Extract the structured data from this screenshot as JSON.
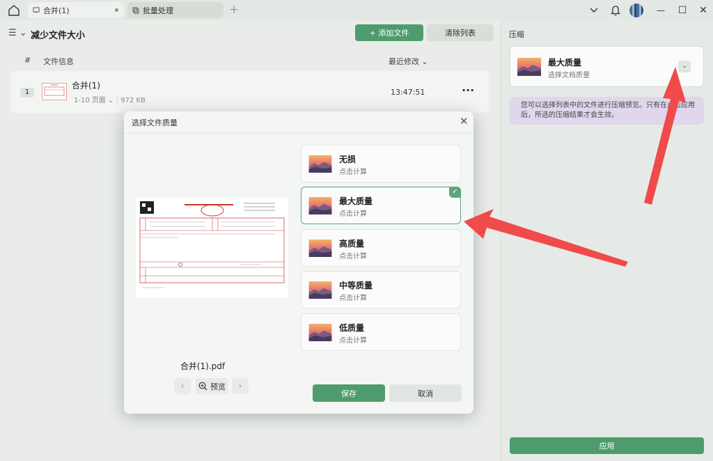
{
  "titlebar": {
    "tabs": [
      {
        "label": "合并(1)"
      },
      {
        "label": "批量处理"
      }
    ],
    "plus": "+",
    "window_buttons": {
      "minimize": "—",
      "maximize": "☐",
      "close": "✕"
    }
  },
  "main": {
    "menu_icon": "☰ ⌄",
    "title": "减少文件大小",
    "add_button": "+ 添加文件",
    "clear_button": "清除列表",
    "columns": {
      "index": "#",
      "info": "文件信息",
      "modified": "最近修改 ⌄"
    },
    "files": [
      {
        "index": "1",
        "name": "合并(1)",
        "pages": "1-10 页面 ⌄",
        "size": "972 KB",
        "time": "13:47:51",
        "more": "···"
      }
    ]
  },
  "panel": {
    "title": "压缩",
    "selected_quality": "最大质量",
    "selected_sub": "选择文档质量",
    "dropdown": "⌄",
    "tip": "您可以选择列表中的文件进行压缩预览。只有在点击应用后，所选的压缩结果才会生效。",
    "apply_button": "应用"
  },
  "dialog": {
    "title": "选择文件质量",
    "close": "✕",
    "pdf_name": "合并(1).pdf",
    "prev": "‹",
    "next": "›",
    "zoom_label": "预览",
    "options": [
      {
        "name": "无损",
        "sub": "点击计算",
        "selected": false
      },
      {
        "name": "最大质量",
        "sub": "点击计算",
        "selected": true
      },
      {
        "name": "高质量",
        "sub": "点击计算",
        "selected": false
      },
      {
        "name": "中等质量",
        "sub": "点击计算",
        "selected": false
      },
      {
        "name": "低质量",
        "sub": "点击计算",
        "selected": false
      }
    ],
    "check": "✓",
    "save_button": "保存",
    "cancel_button": "取消"
  },
  "colors": {
    "accent": "#4e9c6d",
    "arrow": "#f04a4a",
    "tip_bg": "#e1d6ec"
  }
}
